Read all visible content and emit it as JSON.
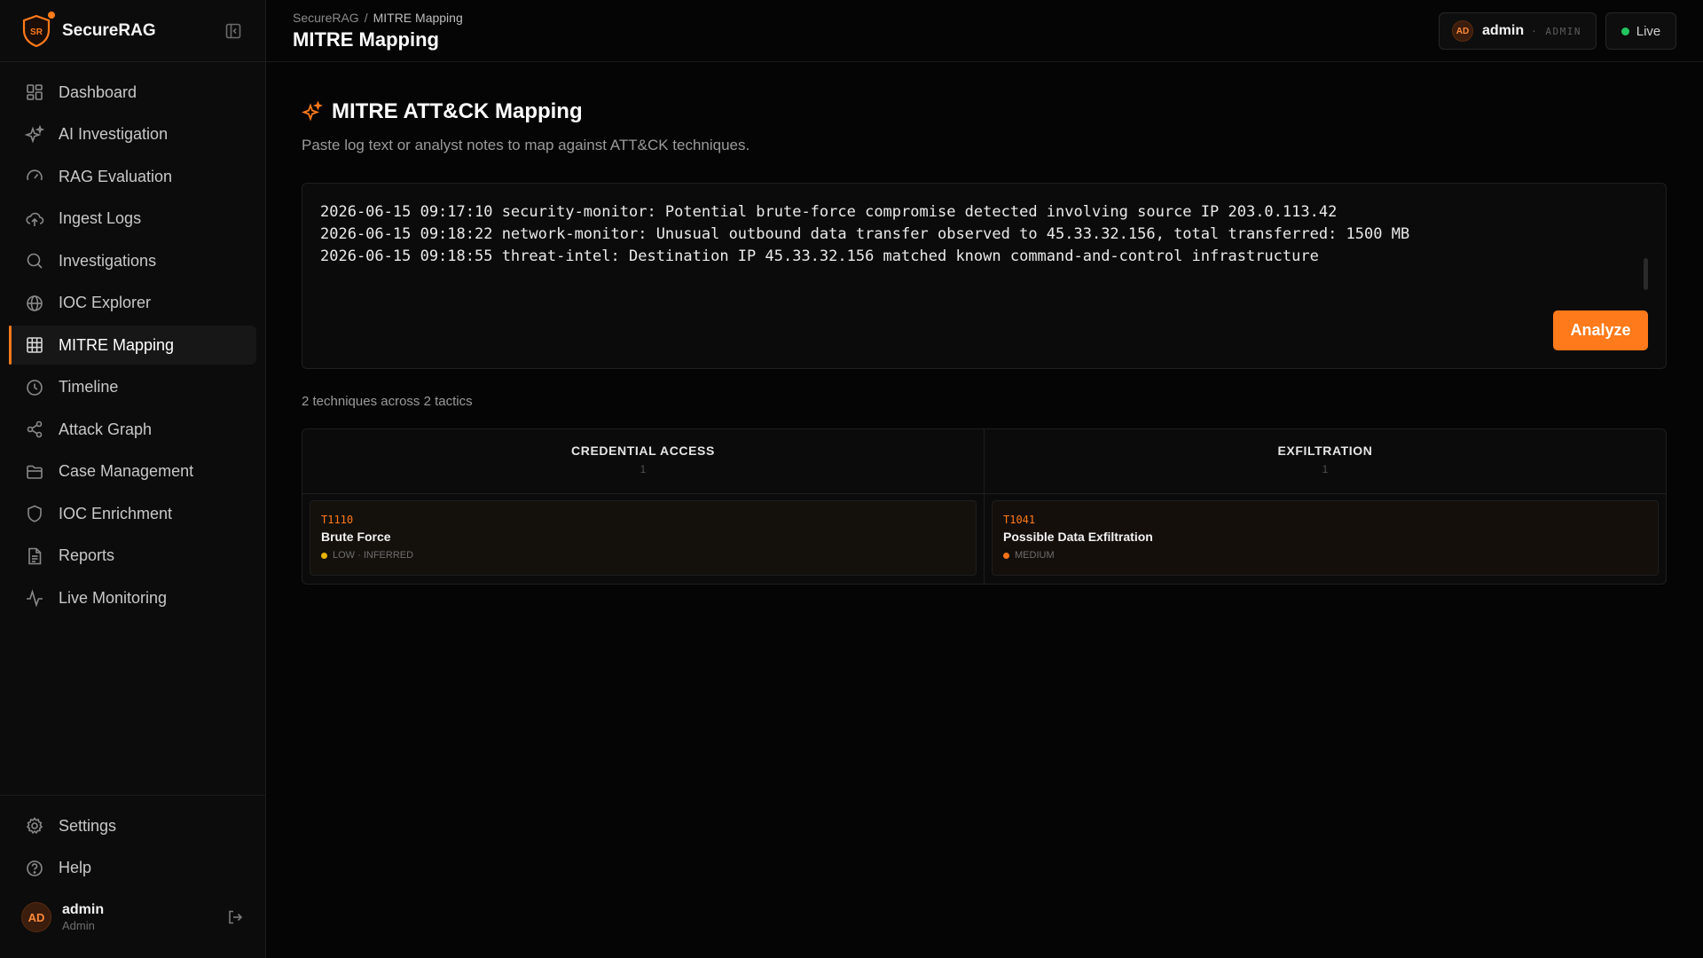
{
  "brand": {
    "name": "SecureRAG",
    "logo_text": "SR",
    "accent": "#ff7a1a"
  },
  "sidebar": {
    "items": [
      {
        "label": "Dashboard",
        "icon": "dashboard-icon"
      },
      {
        "label": "AI Investigation",
        "icon": "sparkles-icon"
      },
      {
        "label": "RAG Evaluation",
        "icon": "gauge-icon"
      },
      {
        "label": "Ingest Logs",
        "icon": "cloud-upload-icon"
      },
      {
        "label": "Investigations",
        "icon": "search-icon"
      },
      {
        "label": "IOC Explorer",
        "icon": "globe-icon"
      },
      {
        "label": "MITRE Mapping",
        "icon": "grid-icon",
        "active": true
      },
      {
        "label": "Timeline",
        "icon": "clock-icon"
      },
      {
        "label": "Attack Graph",
        "icon": "share-icon"
      },
      {
        "label": "Case Management",
        "icon": "folder-icon"
      },
      {
        "label": "IOC Enrichment",
        "icon": "shield-icon"
      },
      {
        "label": "Reports",
        "icon": "file-text-icon"
      },
      {
        "label": "Live Monitoring",
        "icon": "activity-icon"
      }
    ],
    "bottom_items": [
      {
        "label": "Settings",
        "icon": "gear-icon"
      },
      {
        "label": "Help",
        "icon": "help-circle-icon"
      }
    ],
    "user": {
      "initials": "AD",
      "name": "admin",
      "role": "Admin"
    }
  },
  "topbar": {
    "breadcrumb": {
      "root": "SecureRAG",
      "separator": "/",
      "current": "MITRE Mapping"
    },
    "title": "MITRE Mapping",
    "user": {
      "initials": "AD",
      "name": "admin",
      "role": "· ADMIN"
    },
    "live_label": "Live",
    "live_color": "#22c55e"
  },
  "main": {
    "title": "MITRE ATT&CK Mapping",
    "subtitle": "Paste log text or analyst notes to map against ATT&CK techniques.",
    "log_input": "2026-06-15 09:17:10 security-monitor: Potential brute-force compromise detected involving source IP 203.0.113.42\n2026-06-15 09:18:22 network-monitor: Unusual outbound data transfer observed to 45.33.32.156, total transferred: 1500 MB\n2026-06-15 09:18:55 threat-intel: Destination IP 45.33.32.156 matched known command-and-control infrastructure",
    "analyze_label": "Analyze",
    "summary": "2 techniques across 2 tactics",
    "tactics": [
      {
        "name": "CREDENTIAL ACCESS",
        "count": "1",
        "techniques": [
          {
            "id": "T1110",
            "name": "Brute Force",
            "meta": "LOW · INFERRED",
            "severity_color": "#eab308"
          }
        ]
      },
      {
        "name": "EXFILTRATION",
        "count": "1",
        "techniques": [
          {
            "id": "T1041",
            "name": "Possible Data Exfiltration",
            "meta": "MEDIUM",
            "severity_color": "#f97316"
          }
        ]
      }
    ]
  }
}
